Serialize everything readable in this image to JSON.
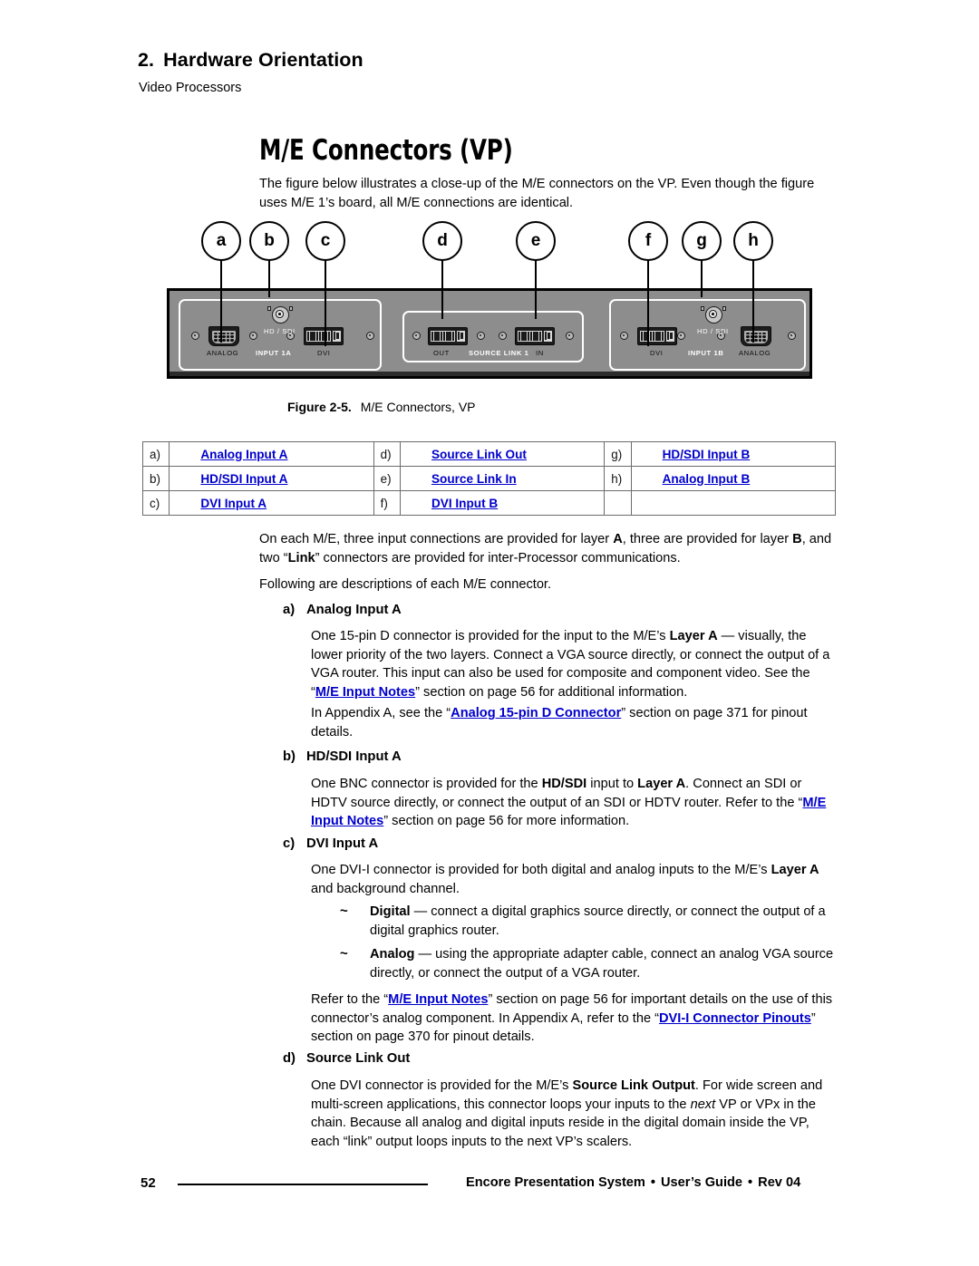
{
  "header": {
    "chapter_number": "2.",
    "chapter_title": "Hardware Orientation",
    "subtitle": "Video Processors"
  },
  "section": {
    "heading": "M/E Connectors (VP)",
    "intro": "The figure below illustrates a close-up of the M/E connectors on the VP.  Even though the figure uses M/E 1’s board, all M/E connections are identical."
  },
  "figure": {
    "caption_label": "Figure 2-5.",
    "caption_text": "M/E Connectors, VP",
    "callouts": [
      {
        "id": "a",
        "label": "a"
      },
      {
        "id": "b",
        "label": "b"
      },
      {
        "id": "c",
        "label": "c"
      },
      {
        "id": "d",
        "label": "d"
      },
      {
        "id": "e",
        "label": "e"
      },
      {
        "id": "f",
        "label": "f"
      },
      {
        "id": "g",
        "label": "g"
      },
      {
        "id": "h",
        "label": "h"
      }
    ],
    "panel_a": {
      "analog_label": "ANALOG",
      "group_label": "INPUT 1A",
      "dvi_label": "DVI",
      "hdsdi_label": "HD / SDI"
    },
    "panel_link": {
      "out_label": "OUT",
      "group_label": "SOURCE LINK 1",
      "in_label": "IN"
    },
    "panel_b": {
      "dvi_label": "DVI",
      "group_label": "INPUT 1B",
      "analog_label": "ANALOG",
      "hdsdi_label": "HD / SDI"
    },
    "colors": {
      "chassis": "#8d8d8d",
      "panel_outline": "#ffffff",
      "connector_body": "#1c1c1c"
    }
  },
  "legend_table": {
    "rows": [
      [
        {
          "key": "a)",
          "value": "Analog Input A"
        },
        {
          "key": "d)",
          "value": "Source Link Out"
        },
        {
          "key": "g)",
          "value": "HD/SDI Input B"
        }
      ],
      [
        {
          "key": "b)",
          "value": "HD/SDI Input A"
        },
        {
          "key": "e)",
          "value": "Source Link In"
        },
        {
          "key": "h)",
          "value": "Analog Input B"
        }
      ],
      [
        {
          "key": "c)",
          "value": "DVI Input A"
        },
        {
          "key": "f)",
          "value": "DVI Input B"
        },
        {
          "key": "",
          "value": ""
        }
      ]
    ]
  },
  "body": {
    "para_overview_1": "On each M/E, three input connections are provided for layer ",
    "para_overview_1_b1": "A",
    "para_overview_1_m1": ", three are provided for layer ",
    "para_overview_1_b2": "B",
    "para_overview_1_m2": ", and two “",
    "para_overview_1_b3": "Link",
    "para_overview_1_m3": "” connectors are provided for inter-Processor communications.",
    "para_overview_2": "Following are descriptions of each M/E connector."
  },
  "items": {
    "a": {
      "marker": "a)",
      "title": "Analog Input A",
      "p1_t1": "One 15-pin D connector is provided for the input to the M/E’s ",
      "p1_b1": "Layer A",
      "p1_t2": " — visually, the lower priority of the two layers.  Connect a VGA source directly, or connect the output of a VGA router.  This input can also be used for composite and component video.  See the “",
      "p1_link": "M/E Input Notes",
      "p1_t3": "” section on page 56 for additional information.",
      "p2_t1": "In Appendix A, see the “",
      "p2_link": "Analog 15-pin D Connector",
      "p2_t2": "” section on page 371 for pinout details."
    },
    "b": {
      "marker": "b)",
      "title": "HD/SDI Input A",
      "p1_t1": "One BNC connector is provided for the ",
      "p1_b1": "HD/SDI",
      "p1_t2": " input to ",
      "p1_b2": "Layer A",
      "p1_t3": ".  Connect an SDI or HDTV source directly, or connect the output of an SDI or HDTV router.  Refer to the “",
      "p1_link": "M/E Input Notes",
      "p1_t4": "” section on page 56 for more information."
    },
    "c": {
      "marker": "c)",
      "title": "DVI Input A",
      "p1_t1": "One DVI-I connector is provided for both digital and analog inputs to the M/E’s ",
      "p1_b1": "Layer A",
      "p1_t2": " and background channel.",
      "bullet1_marker": "~",
      "bullet1_b": "Digital",
      "bullet1_t": " — connect a digital graphics source directly, or connect the output of a digital graphics router.",
      "bullet2_marker": "~",
      "bullet2_b": "Analog",
      "bullet2_t": " — using the appropriate adapter cable, connect an analog VGA source directly, or connect the output of a VGA router.",
      "p2_t1": "Refer to the “",
      "p2_link1": "M/E Input Notes",
      "p2_t2": "” section on page 56 for important details on the use of this connector’s analog component.  In Appendix A, refer to the “",
      "p2_link2": "DVI-I Connector Pinouts",
      "p2_t3": "” section on page 370 for pinout details."
    },
    "d": {
      "marker": "d)",
      "title": "Source Link Out",
      "p1_t1": "One DVI connector is provided for the M/E’s ",
      "p1_b1": "Source Link Output",
      "p1_t2": ".  For wide screen and multi-screen applications, this connector loops your inputs to the ",
      "p1_i1": "next",
      "p1_t3": " VP or VPx in the chain.  Because all analog and digital inputs reside in the digital domain inside the VP, each “link” output loops inputs to the next VP’s scalers."
    }
  },
  "footer": {
    "page_number": "52",
    "product": "Encore Presentation System",
    "sep1": "•",
    "guide": "User’s Guide",
    "sep2": "•",
    "revision": "Rev 04"
  },
  "colors": {
    "link": "#0000cc",
    "text": "#000000",
    "page_background": "#ffffff"
  }
}
